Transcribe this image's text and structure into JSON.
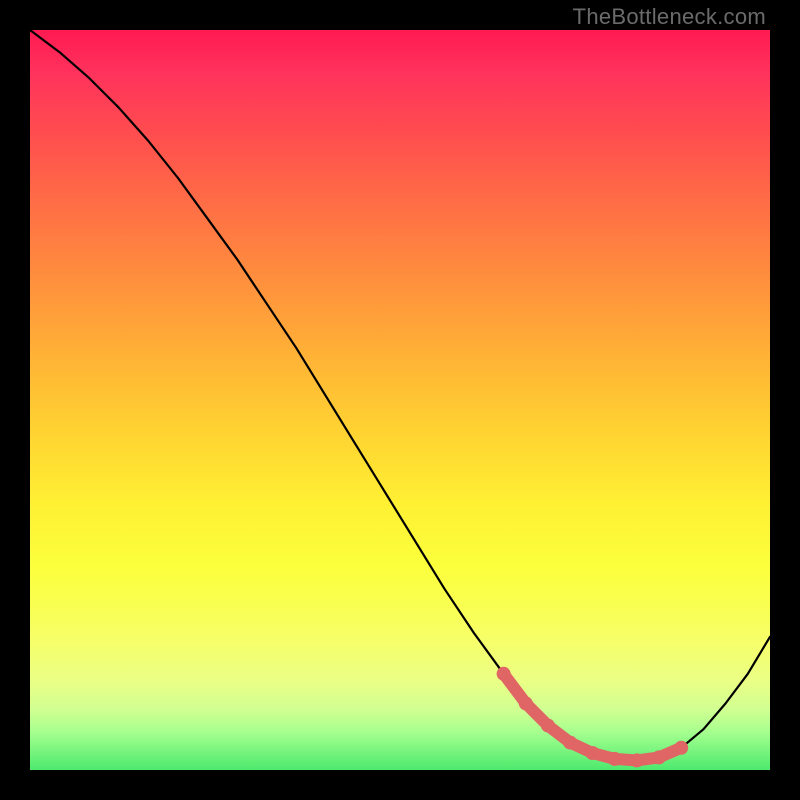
{
  "watermark": "TheBottleneck.com",
  "colors": {
    "background": "#000000",
    "curve": "#000000",
    "highlight": "#e06666",
    "gradient_top": "#ff1a52",
    "gradient_bottom": "#4de96e"
  },
  "chart_data": {
    "type": "line",
    "title": "",
    "xlabel": "",
    "ylabel": "",
    "xlim": [
      0,
      100
    ],
    "ylim": [
      0,
      100
    ],
    "series": [
      {
        "name": "bottleneck-curve",
        "x": [
          0,
          4,
          8,
          12,
          16,
          20,
          24,
          28,
          32,
          36,
          40,
          44,
          48,
          52,
          56,
          60,
          64,
          67,
          70,
          73,
          76,
          79,
          82,
          85,
          88,
          91,
          94,
          97,
          100
        ],
        "y": [
          100,
          97,
          93.5,
          89.5,
          85,
          80,
          74.5,
          69,
          63,
          57,
          50.5,
          44,
          37.5,
          31,
          24.5,
          18.5,
          13,
          9,
          6,
          3.7,
          2.3,
          1.5,
          1.3,
          1.7,
          3,
          5.5,
          9,
          13,
          18
        ]
      }
    ],
    "highlight": {
      "name": "optimal-range",
      "x": [
        64,
        67,
        70,
        73,
        76,
        79,
        82,
        85,
        88
      ],
      "y": [
        13,
        9,
        6,
        3.7,
        2.3,
        1.5,
        1.3,
        1.7,
        3
      ]
    }
  }
}
